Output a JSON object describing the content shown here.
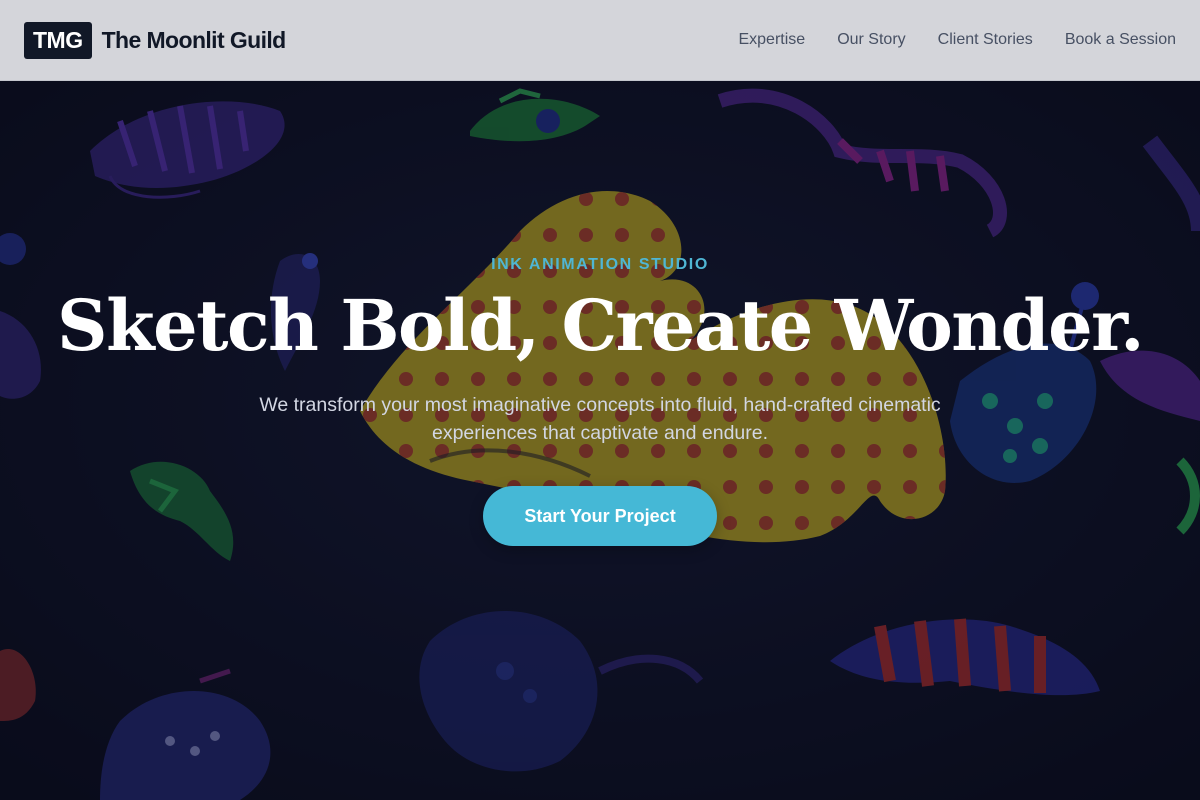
{
  "header": {
    "logo_text": "TMG",
    "brand_name": "The Moonlit Guild",
    "nav": [
      {
        "label": "Expertise"
      },
      {
        "label": "Our Story"
      },
      {
        "label": "Client Stories"
      },
      {
        "label": "Book a Session"
      }
    ]
  },
  "hero": {
    "eyebrow": "INK ANIMATION STUDIO",
    "headline": "Sketch Bold, Create Wonder.",
    "subtext": "We transform your most imaginative concepts into fluid, hand-crafted cinematic experiences that captivate and endure.",
    "cta_label": "Start Your Project",
    "background_image": "ink-creatures-illustration"
  },
  "colors": {
    "header_bg": "#d4d5da",
    "logo_bg": "#111827",
    "accent": "#45b8d6",
    "eyebrow": "#4fb6d4",
    "hero_bg": "#0c0f20"
  }
}
